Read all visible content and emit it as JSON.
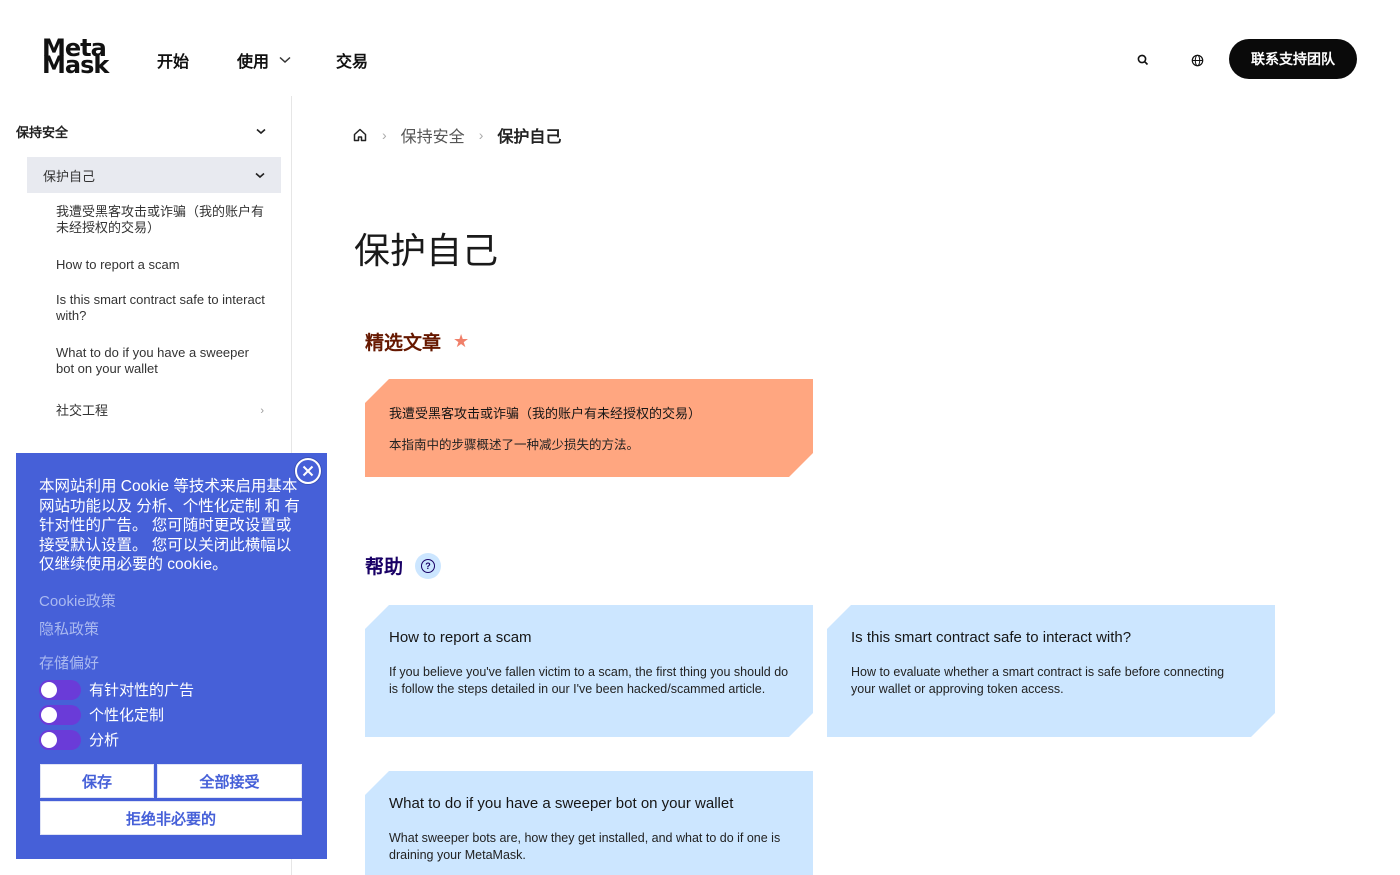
{
  "header": {
    "logo_line1": "Meta",
    "logo_line2": "Mask",
    "nav": [
      {
        "label": "开始"
      },
      {
        "label": "使用"
      },
      {
        "label": "交易"
      }
    ],
    "support_button": "联系支持团队"
  },
  "sidebar": {
    "section": "保持安全",
    "active": "保护自己",
    "links": [
      "我遭受黑客攻击或诈骗（我的账户有未经授权的交易）",
      "How to report a scam",
      "Is this smart contract safe to interact with?",
      "What to do if you have a sweeper bot on your wallet",
      "社交工程"
    ]
  },
  "breadcrumb": {
    "level1": "保持安全",
    "level2": "保护自己"
  },
  "page_title": "保护自己",
  "featured": {
    "heading": "精选文章",
    "card": {
      "title": "我遭受黑客攻击或诈骗（我的账户有未经授权的交易）",
      "desc": "本指南中的步骤概述了一种减少损失的方法。"
    }
  },
  "help": {
    "heading": "帮助",
    "cards": [
      {
        "title": "How to report a scam",
        "desc": "If you believe you've fallen victim to a scam, the first thing you should do is follow the steps detailed in our I've been hacked/scammed article."
      },
      {
        "title": "Is this smart contract safe to interact with?",
        "desc": "How to evaluate whether a smart contract is safe before connecting your wallet or approving token access."
      },
      {
        "title": "What to do if you have a sweeper bot on your wallet",
        "desc": "What sweeper bots are, how they get installed, and what to do if one is draining your MetaMask."
      }
    ]
  },
  "cookie": {
    "text": "本网站利用 Cookie 等技术来启用基本网站功能以及 分析、个性化定制 和 有针对性的广告。 您可随时更改设置或接受默认设置。 您可以关闭此横幅以仅继续使用必要的 cookie。",
    "cookie_policy": "Cookie政策",
    "privacy_policy": "隐私政策",
    "pref_title": "存储偏好",
    "toggles": [
      "有针对性的广告",
      "个性化定制",
      "分析"
    ],
    "save": "保存",
    "accept_all": "全部接受",
    "reject": "拒绝非必要的"
  },
  "colors": {
    "featured_card": "#ffa680",
    "help_card": "#cce6ff",
    "cookie_bg": "#4660d8",
    "featured_heading": "#661800",
    "help_heading": "#190066"
  }
}
